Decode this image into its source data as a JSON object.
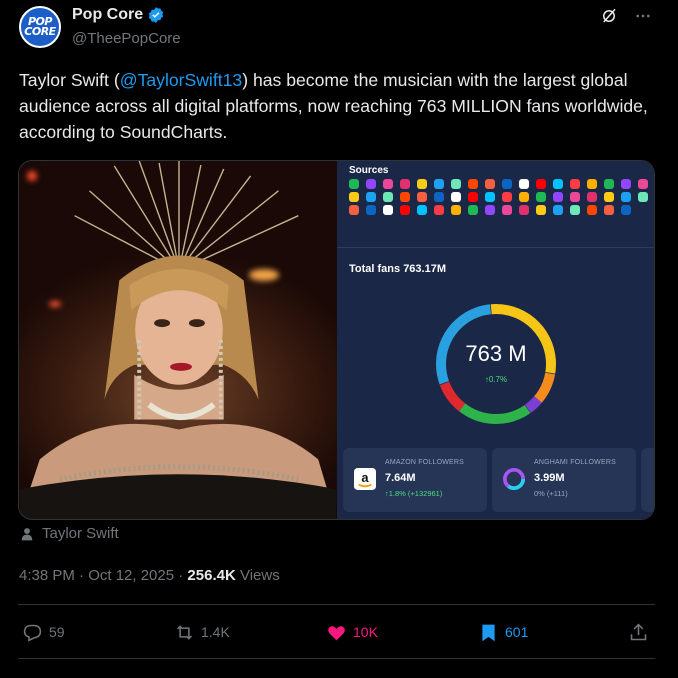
{
  "author": {
    "display_name": "Pop Core",
    "handle": "@TheePopCore",
    "avatar_line1": "POP",
    "avatar_line2": "CORE"
  },
  "tweet": {
    "text_before": "Taylor Swift (",
    "mention": "@TaylorSwift13",
    "text_after": ") has become the musician with the largest global audience across all digital platforms, now reaching 763 MILLION fans worldwide, according to SoundCharts."
  },
  "media": {
    "sources_label": "Sources",
    "total_fans_label": "Total fans 763.17M",
    "donut_value": "763 M",
    "donut_change": "↑0.7%",
    "cards": [
      {
        "title": "AMAZON FOLLOWERS",
        "value": "7.64M",
        "change": "↑1.8% (+132961)",
        "change_color": "#4ade80"
      },
      {
        "title": "ANGHAMI FOLLOWERS",
        "value": "3.99M",
        "change": "0% (+111)",
        "change_color": "#9aa7c2"
      }
    ]
  },
  "caption": "Taylor Swift",
  "meta": {
    "time": "4:38 PM · Oct 12, 2025 · ",
    "views_count": "256.4K",
    "views_label": " Views"
  },
  "actions": {
    "replies": "59",
    "reposts": "1.4K",
    "likes": "10K",
    "bookmarks": "601"
  },
  "colors": {
    "accent": "#1d9bf0",
    "like": "#f91880",
    "muted": "#71767b",
    "panel": "#1b2747"
  }
}
